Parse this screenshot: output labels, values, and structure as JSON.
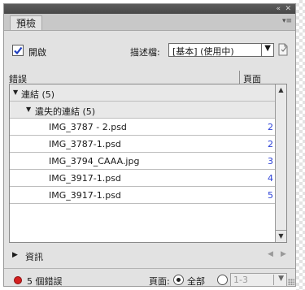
{
  "titlebar": {
    "collapse": "«",
    "close": "✕"
  },
  "tab": {
    "label": "預檢",
    "menu_icon": "▾≡"
  },
  "enable": {
    "checked": true,
    "label": "開啟"
  },
  "profile": {
    "label": "描述檔:",
    "value": "[基本] (使用中)",
    "arrow": "▼"
  },
  "table": {
    "col_error": "錯誤",
    "col_page": "頁面",
    "rows": [
      {
        "indent": 0,
        "expander": "▼",
        "label": "連結 (5)",
        "page": "",
        "group": true
      },
      {
        "indent": 1,
        "expander": "▼",
        "label": "遺失的連結 (5)",
        "page": "",
        "group": true
      },
      {
        "indent": 2,
        "expander": "",
        "label": "IMG_3787 - 2.psd",
        "page": "2",
        "group": false
      },
      {
        "indent": 2,
        "expander": "",
        "label": "IMG_3787-1.psd",
        "page": "2",
        "group": false
      },
      {
        "indent": 2,
        "expander": "",
        "label": "IMG_3794_CAAA.jpg",
        "page": "3",
        "group": false
      },
      {
        "indent": 2,
        "expander": "",
        "label": "IMG_3917-1.psd",
        "page": "4",
        "group": false
      },
      {
        "indent": 2,
        "expander": "",
        "label": "IMG_3917-1.psd",
        "page": "5",
        "group": false
      }
    ],
    "scroll_up": "▲",
    "scroll_down": "▼"
  },
  "info": {
    "expander": "▶",
    "label": "資訊",
    "prev": "◀",
    "next": "▶"
  },
  "status": {
    "error_color": "#d42020",
    "error_text": "5 個錯誤",
    "pages_label": "頁面:",
    "all_label": "全部",
    "range_value": "1-3",
    "range_arrow": "▼"
  },
  "colors": {
    "page_link": "#2a3fd6",
    "titlebar": "#505050"
  }
}
